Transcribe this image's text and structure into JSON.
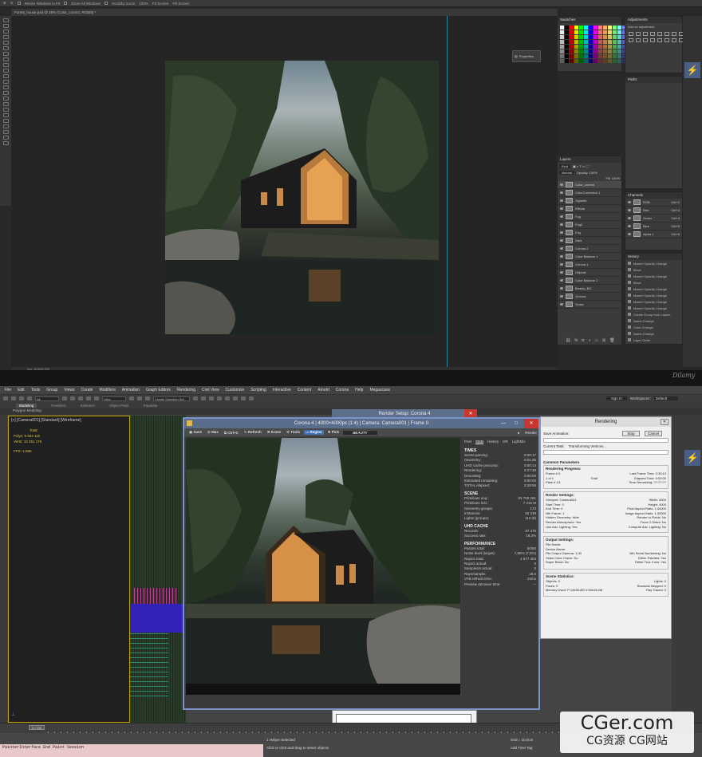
{
  "photoshop": {
    "options_bar": [
      "Resize Windows to Fit",
      "Zoom All Windows",
      "Scrubby Zoom",
      "100%",
      "Fit Screen",
      "Fill Screen"
    ],
    "doc_tab": "Forest_house.psd @ 25% (Color_correct, RGB/8) *",
    "properties_label": "Properties",
    "swatches_title": "Swatches",
    "adjustments_title": "Adjustments",
    "adjustments_hint": "Add an adjustment",
    "paths_title": "Paths",
    "layers_title": "Layers",
    "layers_kind": "Kind",
    "layers_blend": "Normal",
    "layers_opacity": "Opacity: 100%",
    "layers_fill": "Fill: 100%",
    "layers": [
      "Color_correct",
      "ColorCorrection 1",
      "Vignette",
      "Effects",
      "Fog",
      "Fog2",
      "Fog",
      "Dark",
      "Corona 2",
      "Color Balance 1",
      "Corona 1",
      "Objects",
      "Color Balance 2",
      "Beauty_BG",
      "Ground",
      "Grass"
    ],
    "channels_title": "Channels",
    "channels": [
      {
        "name": "RGB",
        "key": "Ctrl+2"
      },
      {
        "name": "Red",
        "key": "Ctrl+3"
      },
      {
        "name": "Green",
        "key": "Ctrl+4"
      },
      {
        "name": "Blue",
        "key": "Ctrl+5"
      },
      {
        "name": "Alpha 1",
        "key": "Ctrl+6"
      }
    ],
    "history_title": "History",
    "history": [
      "Master Opacity Change",
      "Move",
      "Master Opacity Change",
      "Move",
      "Master Opacity Change",
      "Master Opacity Change",
      "Master Opacity Change",
      "Master Opacity Change",
      "Create Group from Layers",
      "Name Change",
      "Color Change",
      "Name Change",
      "Layer Order",
      "Lens Correction",
      "Camera Raw Filter",
      "Name Change Demo"
    ],
    "status": "Doc: 45.8M/1.05G"
  },
  "watermark_small": "Dilamy",
  "max": {
    "menu": [
      "File",
      "Edit",
      "Tools",
      "Group",
      "Views",
      "Create",
      "Modifiers",
      "Animation",
      "Graph Editors",
      "Rendering",
      "Civil View",
      "Customize",
      "Scripting",
      "Interactive",
      "Content",
      "Arnold",
      "Corona",
      "Help",
      "Megascans"
    ],
    "toolbar_dd": [
      "All",
      "View",
      "Create Selection Set"
    ],
    "sign_in": "Sign In",
    "workspaces_label": "Workspaces:",
    "workspaces_value": "Default",
    "ribbon": [
      "Modeling",
      "Freeform",
      "Selection",
      "Object Paint",
      "Populate"
    ],
    "poly_modeling": "Polygon Modeling",
    "viewport_label": "[+] [Camera001] [Standard] [Wireframe]",
    "stats": {
      "total": "Total",
      "polys": "Polys:  5 604 115",
      "verts": "Verts:  10 451 176",
      "fps": "FPS:     1,566"
    },
    "frame_counter": "0 / 100",
    "listener": "PainterInterface End Paint Session",
    "helper_selected": "1 Helper Selected",
    "prompt": "Click or click-and-drag to select objects",
    "grid": "Grid = 10,0cm",
    "add_time_tag": "Add Time Tag"
  },
  "corona_vfb": {
    "title": "Corona 4 | 4000×4000px (1:4) | Camera: Camera001 | Frame 0",
    "toolbar": [
      "Save",
      "Max",
      "Ctrl+C",
      "Refresh",
      "Erase",
      "Tools",
      "Region",
      "Pick"
    ],
    "render_button": "Render",
    "beauty": "BEAUTY",
    "side_tabs": [
      "Post",
      "Stats",
      "History",
      "DR",
      "LightMix"
    ],
    "times_title": "TIMES",
    "times": [
      [
        "Scene parsing:",
        "0:00:17"
      ],
      [
        "Geometry:",
        "0:01:36"
      ],
      [
        "UHD cache precomp:",
        "0:00:14"
      ],
      [
        "Rendering:",
        "2:27:48"
      ],
      [
        "Denoising:",
        "0:00:00"
      ],
      [
        "Estimated remaining:",
        "0:00:00"
      ],
      [
        "TOTAL elapsed:",
        "2:29:55"
      ]
    ],
    "scene_title": "SCENE",
    "scene": [
      [
        "Primitives unq.:",
        "91 700 261"
      ],
      [
        "Primitives inst.:",
        "7 216 M"
      ],
      [
        "Geometry groups:",
        "173"
      ],
      [
        "Instances:",
        "92 249"
      ],
      [
        "Lights (groups):",
        "113 (8)"
      ]
    ],
    "uhd_title": "UHD CACHE",
    "uhd": [
      [
        "Records:",
        "37 475"
      ],
      [
        "Success rate:",
        "18,3%"
      ]
    ],
    "perf_title": "PERFORMANCE",
    "perf": [
      [
        "Passes total:",
        "50/50"
      ],
      [
        "Noise level (target):",
        "7,86% (7,0%)"
      ],
      [
        "Rays/s total:",
        "1 677 303"
      ],
      [
        "Rays/s actual:",
        "0"
      ],
      [
        "Samples/s actual:",
        "0"
      ],
      [
        "Rays/sample:",
        "18,0"
      ],
      [
        "VFB refresh time:",
        "22ms"
      ],
      [
        "Preview denoiser time:",
        "---"
      ]
    ]
  },
  "render_setup": {
    "title": "Render Setup: Corona 4"
  },
  "rendering_dialog": {
    "title": "Rendering",
    "animation_label": "Save Animation:",
    "stop": "Stop",
    "cancel": "Cancel",
    "current_task_label": "Current Task:",
    "current_task": "Transforming Vertices...",
    "common_title": "Common Parameters",
    "progress_title": "Rendering Progress:",
    "frame_line": "Frame #    0",
    "of_line": "1 of 1",
    "passes_line": "Pass #  1/1",
    "total": "Total",
    "last_frame": "Last Frame Time:  2:30:13",
    "elapsed": "Elapsed Time:  0:00:00",
    "remaining": "Time Remaining:  ??:??:??",
    "render_settings_title": "Render Settings:",
    "settings": [
      [
        "Viewport:  Camera001",
        "Width:  4000"
      ],
      [
        "Start Time:  0",
        "Height:  4000"
      ],
      [
        "End Time:  0",
        "Pixel Aspect Ratio:  1,00000"
      ],
      [
        "Nth Frame:  1",
        "Image Aspect Ratio:  1,00000"
      ],
      [
        "Hidden Geometry:  Hide",
        "Render to Fields:  No"
      ],
      [
        "Render Atmosphere:  Yes",
        "Force 2-Sided:  No"
      ],
      [
        "Use Adv. Lighting:  Yes",
        "Compute Adv. Lighting:  No"
      ]
    ],
    "output_title": "Output Settings:",
    "output": [
      [
        "File Name:",
        ""
      ],
      [
        "Device Name:",
        ""
      ],
      [
        "File Output Gamma:  1,00",
        "Nth Serial Numbering:  No"
      ],
      [
        "Video Color Check:  No",
        "Dither Paletted:  Yes"
      ],
      [
        "Super Black:  No",
        "Dither True Color:  Yes"
      ]
    ],
    "scene_stats_title": "Scene Statistics:",
    "scene_stats": [
      [
        "Objects:  0",
        "Lights:  0"
      ],
      [
        "Faces:  0",
        "Shadows Mapped:  0"
      ],
      [
        "Memory Used:  P:14635,8M V:39418,2M",
        "Ray Traced:  0"
      ]
    ]
  },
  "cger_watermark": {
    "main": "CGer.com",
    "sub": "CG资源 CG网站"
  },
  "colors": {
    "ps_bg": "#282828",
    "max_bg": "#444444",
    "vfb_border": "#7a93c8",
    "accent_blue": "#3e6fb8",
    "close_red": "#c8372d"
  }
}
